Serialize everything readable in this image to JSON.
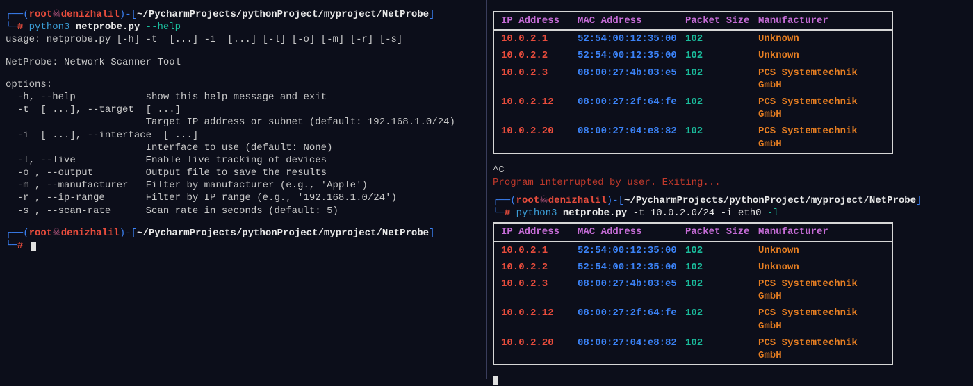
{
  "prompt": {
    "user": "root",
    "skull": "☠",
    "host": "denizhalil",
    "path": "~/PycharmProjects/pythonProject/myproject/NetProbe",
    "hash": "#"
  },
  "left": {
    "cmd_prefix": "python3 ",
    "cmd_script": "netprobe.py",
    "cmd_args": " --help",
    "usage": "usage: netprobe.py [-h] -t  [...] -i  [...] [-l] [-o] [-m] [-r] [-s]",
    "desc": "NetProbe: Network Scanner Tool",
    "options_label": "options:",
    "opt_h": "  -h, --help            show this help message and exit",
    "opt_t1": "  -t  [ ...], --target  [ ...]",
    "opt_t2": "                        Target IP address or subnet (default: 192.168.1.0/24)",
    "opt_i1": "  -i  [ ...], --interface  [ ...]",
    "opt_i2": "                        Interface to use (default: None)",
    "opt_l": "  -l, --live            Enable live tracking of devices",
    "opt_o": "  -o , --output         Output file to save the results",
    "opt_m": "  -m , --manufacturer   Filter by manufacturer (e.g., 'Apple')",
    "opt_r": "  -r , --ip-range       Filter by IP range (e.g., '192.168.1.0/24')",
    "opt_s": "  -s , --scan-rate      Scan rate in seconds (default: 5)"
  },
  "right": {
    "ctrlc": "^C",
    "interrupt": "Program interrupted by user. Exiting...",
    "cmd_prefix": "python3 ",
    "cmd_script": "netprobe.py",
    "cmd_args_pre": " -t 10.0.2.0/24 -i eth0",
    "cmd_args_flag": " -l"
  },
  "table": {
    "headers": {
      "ip": "IP Address",
      "mac": "MAC Address",
      "pkt": "Packet Size",
      "mf": "Manufacturer"
    },
    "rows": [
      {
        "ip": "10.0.2.1",
        "mac": "52:54:00:12:35:00",
        "pkt": "102",
        "mf": "Unknown"
      },
      {
        "ip": "10.0.2.2",
        "mac": "52:54:00:12:35:00",
        "pkt": "102",
        "mf": "Unknown"
      },
      {
        "ip": "10.0.2.3",
        "mac": "08:00:27:4b:03:e5",
        "pkt": "102",
        "mf": "PCS Systemtechnik GmbH"
      },
      {
        "ip": "10.0.2.12",
        "mac": "08:00:27:2f:64:fe",
        "pkt": "102",
        "mf": "PCS Systemtechnik GmbH"
      },
      {
        "ip": "10.0.2.20",
        "mac": "08:00:27:04:e8:82",
        "pkt": "102",
        "mf": "PCS Systemtechnik GmbH"
      }
    ]
  }
}
